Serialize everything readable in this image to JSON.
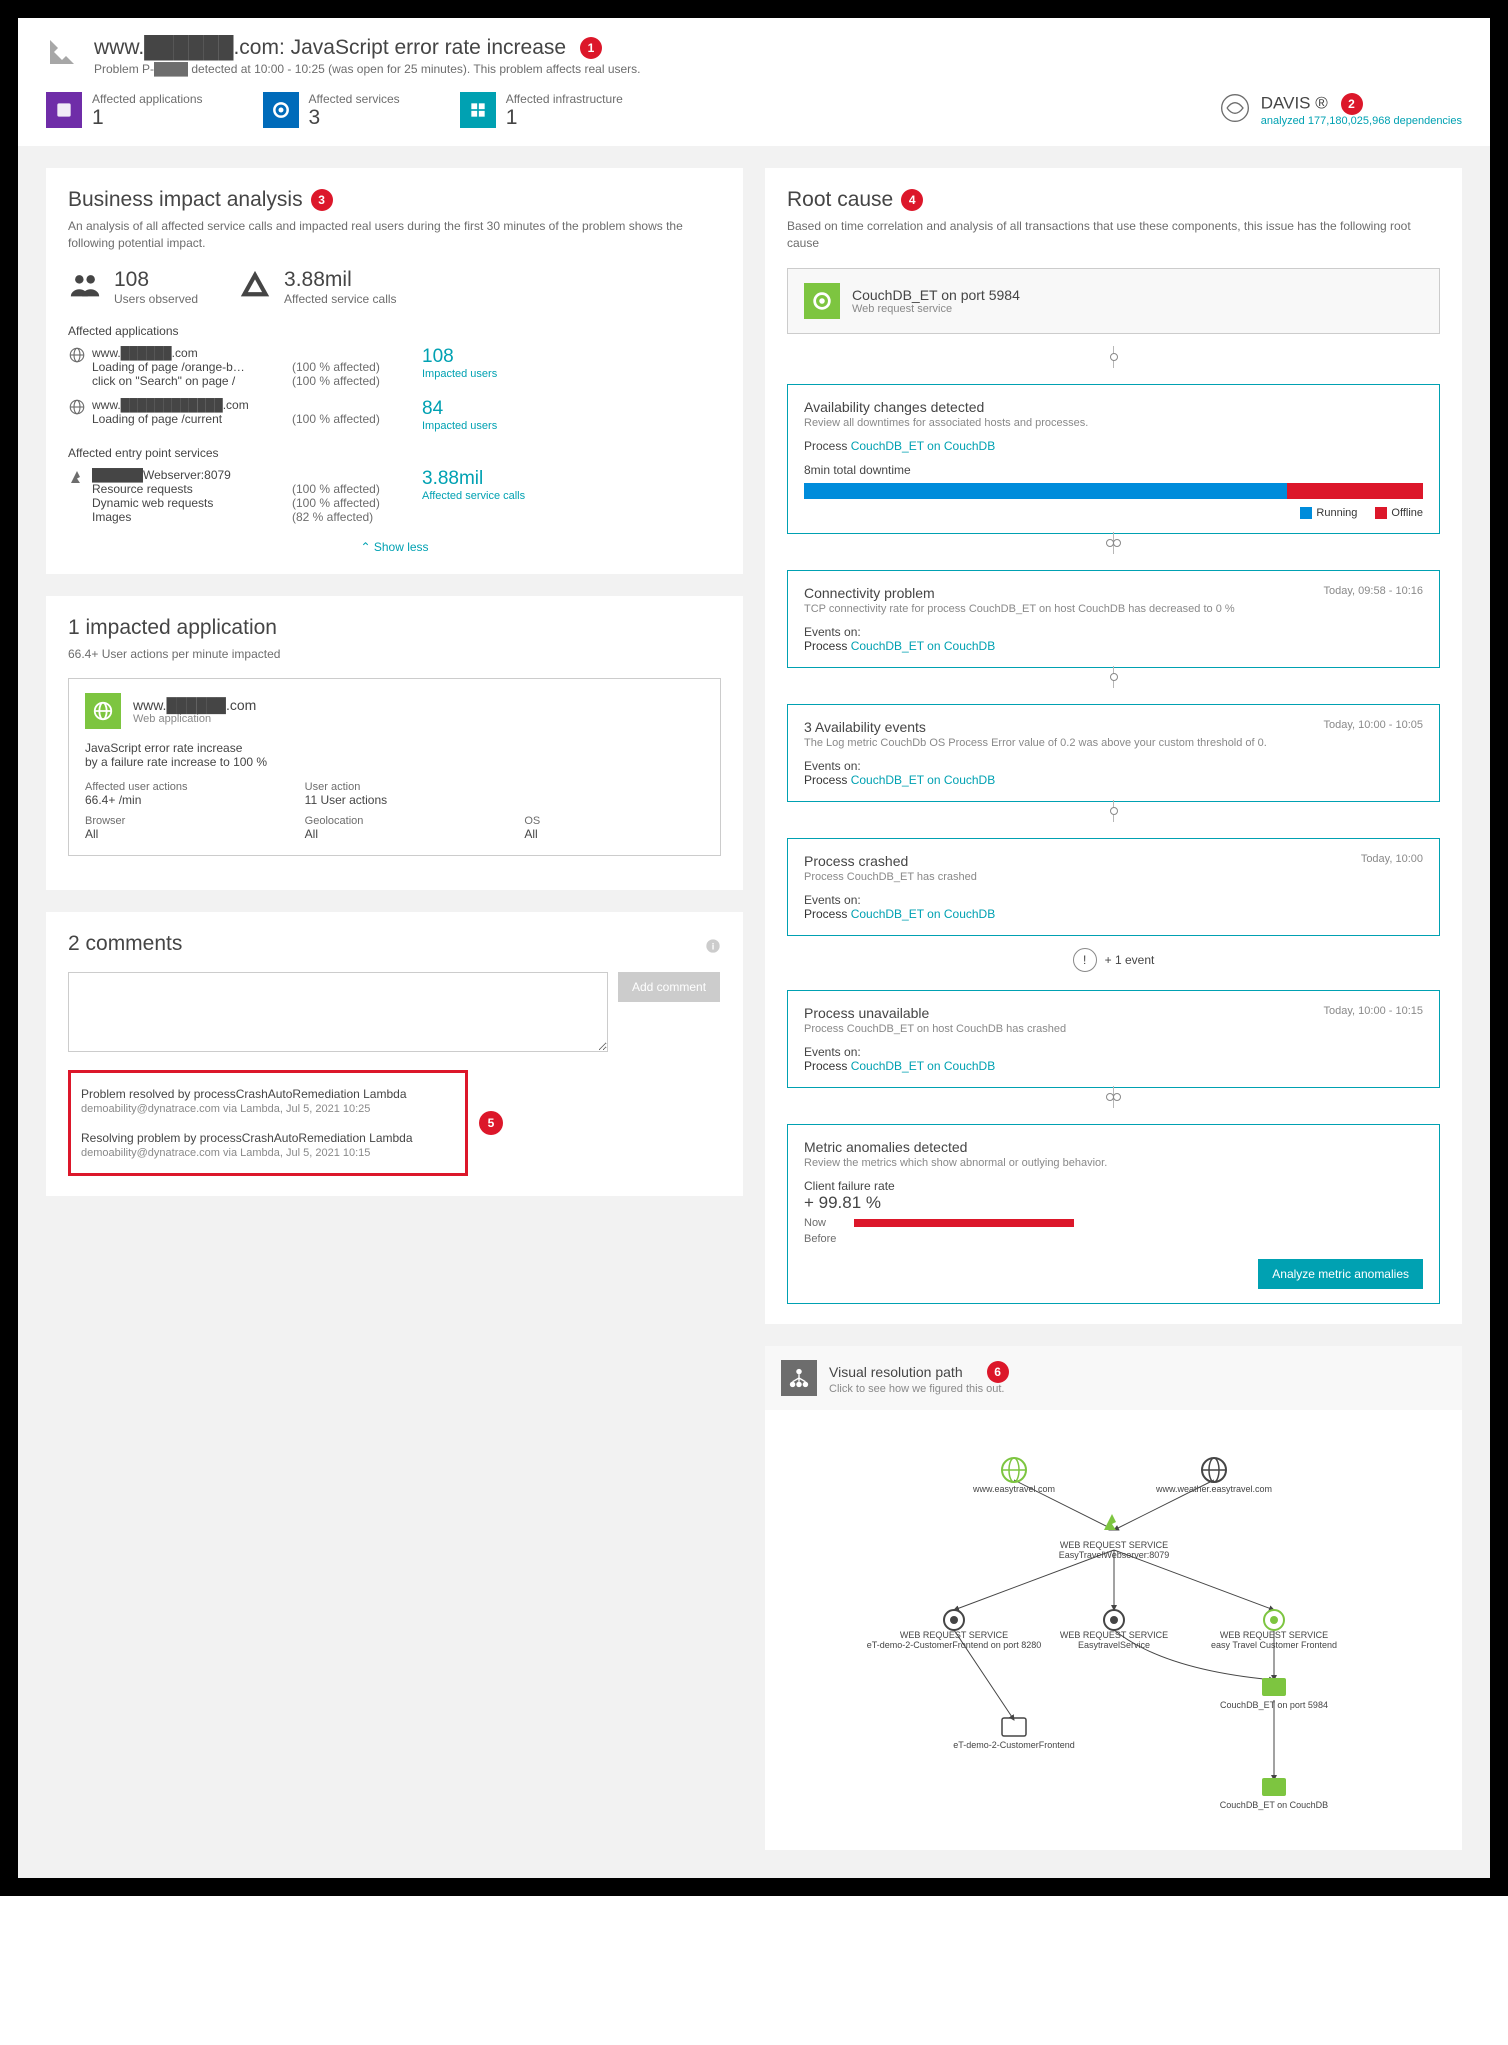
{
  "header": {
    "title": "www.██████.com: JavaScript error rate increase",
    "badge": "1",
    "subtitle": "Problem P-████ detected at 10:00 - 10:25 (was open for 25 minutes). This problem affects real users."
  },
  "tiles": {
    "apps": {
      "label": "Affected applications",
      "value": "1"
    },
    "services": {
      "label": "Affected services",
      "value": "3"
    },
    "infra": {
      "label": "Affected infrastructure",
      "value": "1"
    }
  },
  "davis": {
    "name": "DAVIS ®",
    "badge": "2",
    "sub": "analyzed 177,180,025,968 dependencies"
  },
  "bia": {
    "title": "Business impact analysis",
    "badge": "3",
    "desc": "An analysis of all affected service calls and impacted real users during the first 30 minutes of the problem shows the following potential impact.",
    "users": {
      "value": "108",
      "label": "Users observed"
    },
    "calls": {
      "value": "3.88mil",
      "label": "Affected service calls"
    },
    "apps_head": "Affected applications",
    "app1": {
      "name": "www.██████.com",
      "l1": "Loading of page /orange-b…",
      "l2": "click on \"Search\" on page /",
      "p1": "(100 % affected)",
      "p2": "(100 % affected)",
      "metric": "108",
      "metric_label": "Impacted users"
    },
    "app2": {
      "name": "www.████████████.com",
      "l1": "Loading of page /current",
      "p1": "(100 % affected)",
      "metric": "84",
      "metric_label": "Impacted users"
    },
    "eps_head": "Affected entry point services",
    "eps": {
      "name": "██████Webserver:8079",
      "r1": "Resource requests",
      "r2": "Dynamic web requests",
      "r3": "Images",
      "p1": "(100 % affected)",
      "p2": "(100 % affected)",
      "p3": "(82 % affected)",
      "metric": "3.88mil",
      "metric_label": "Affected service calls"
    },
    "show_less": "Show less"
  },
  "impacted": {
    "title": "1 impacted application",
    "sub": "66.4+ User actions per minute impacted",
    "app_name": "www.██████.com",
    "app_type": "Web application",
    "msg1": "JavaScript error rate increase",
    "msg2": "by a failure rate increase to 100 %",
    "k1l": "Affected user actions",
    "k1v": "66.4+ /min",
    "k2l": "User action",
    "k2v": "11 User actions",
    "k3l": "Browser",
    "k3v": "All",
    "k4l": "Geolocation",
    "k4v": "All",
    "k5l": "OS",
    "k5v": "All"
  },
  "comments": {
    "title": "2 comments",
    "add": "Add comment",
    "badge": "5",
    "c1": {
      "text": "Problem resolved by processCrashAutoRemediation Lambda",
      "meta": "demoability@dynatrace.com via Lambda, Jul 5, 2021 10:25"
    },
    "c2": {
      "text": "Resolving problem by processCrashAutoRemediation Lambda",
      "meta": "demoability@dynatrace.com via Lambda, Jul 5, 2021 10:15"
    }
  },
  "rc": {
    "title": "Root cause",
    "badge": "4",
    "desc": "Based on time correlation and analysis of all transactions that use these components, this issue has the following root cause",
    "head_title": "CouchDB_ET on port 5984",
    "head_sub": "Web request service",
    "avail": {
      "title": "Availability changes detected",
      "sub": "Review all downtimes for associated hosts and processes.",
      "proc_label": "Process",
      "proc_link": "CouchDB_ET on CouchDB",
      "dt": "8min total downtime",
      "leg_run": "Running",
      "leg_off": "Offline"
    },
    "conn": {
      "title": "Connectivity problem",
      "time": "Today, 09:58 - 10:16",
      "sub": "TCP connectivity rate for process CouchDB_ET on host CouchDB has decreased to 0 %",
      "ev": "Events on:",
      "proc": "Process",
      "link": "CouchDB_ET on CouchDB"
    },
    "ae": {
      "title": "3 Availability events",
      "time": "Today, 10:00 - 10:05",
      "sub": "The Log metric CouchDb OS Process Error value of 0.2 was above your custom threshold of 0.",
      "ev": "Events on:",
      "proc": "Process",
      "link": "CouchDB_ET on CouchDB"
    },
    "crash": {
      "title": "Process crashed",
      "time": "Today, 10:00",
      "sub": "Process CouchDB_ET has crashed",
      "ev": "Events on:",
      "proc": "Process",
      "link": "CouchDB_ET on CouchDB"
    },
    "plus": "+ 1 event",
    "unavail": {
      "title": "Process unavailable",
      "time": "Today, 10:00 - 10:15",
      "sub": "Process CouchDB_ET on host CouchDB has crashed",
      "ev": "Events on:",
      "proc": "Process",
      "link": "CouchDB_ET on CouchDB"
    },
    "anom": {
      "title": "Metric anomalies detected",
      "sub": "Review the metrics which show abnormal or outlying behavior.",
      "metric": "Client failure rate",
      "value": "+ 99.81 %",
      "now": "Now",
      "before": "Before",
      "btn": "Analyze metric anomalies"
    }
  },
  "vrp": {
    "title": "Visual resolution path",
    "badge": "6",
    "sub": "Click to see how we figured this out.",
    "n1": "www.easytravel.com",
    "n2": "www.weather.easytravel.com",
    "n3": "EasyTravelWebserver:8079",
    "n4": "eT-demo-2-CustomerFrontend on port 8280",
    "n5": "EasytravelService",
    "n6": "easy Travel Customer Frontend",
    "n7": "CouchDB_ET on port 5984",
    "n8": "eT-demo-2-CustomerFrontend",
    "n9": "CouchDB_ET on CouchDB",
    "svc": "WEB REQUEST SERVICE"
  },
  "chart_data": {
    "type": "bar",
    "title": "Availability (8min total downtime)",
    "categories": [
      "Running",
      "Offline"
    ],
    "values": [
      78,
      22
    ],
    "colors": [
      "#008cdb",
      "#dc172a"
    ]
  }
}
